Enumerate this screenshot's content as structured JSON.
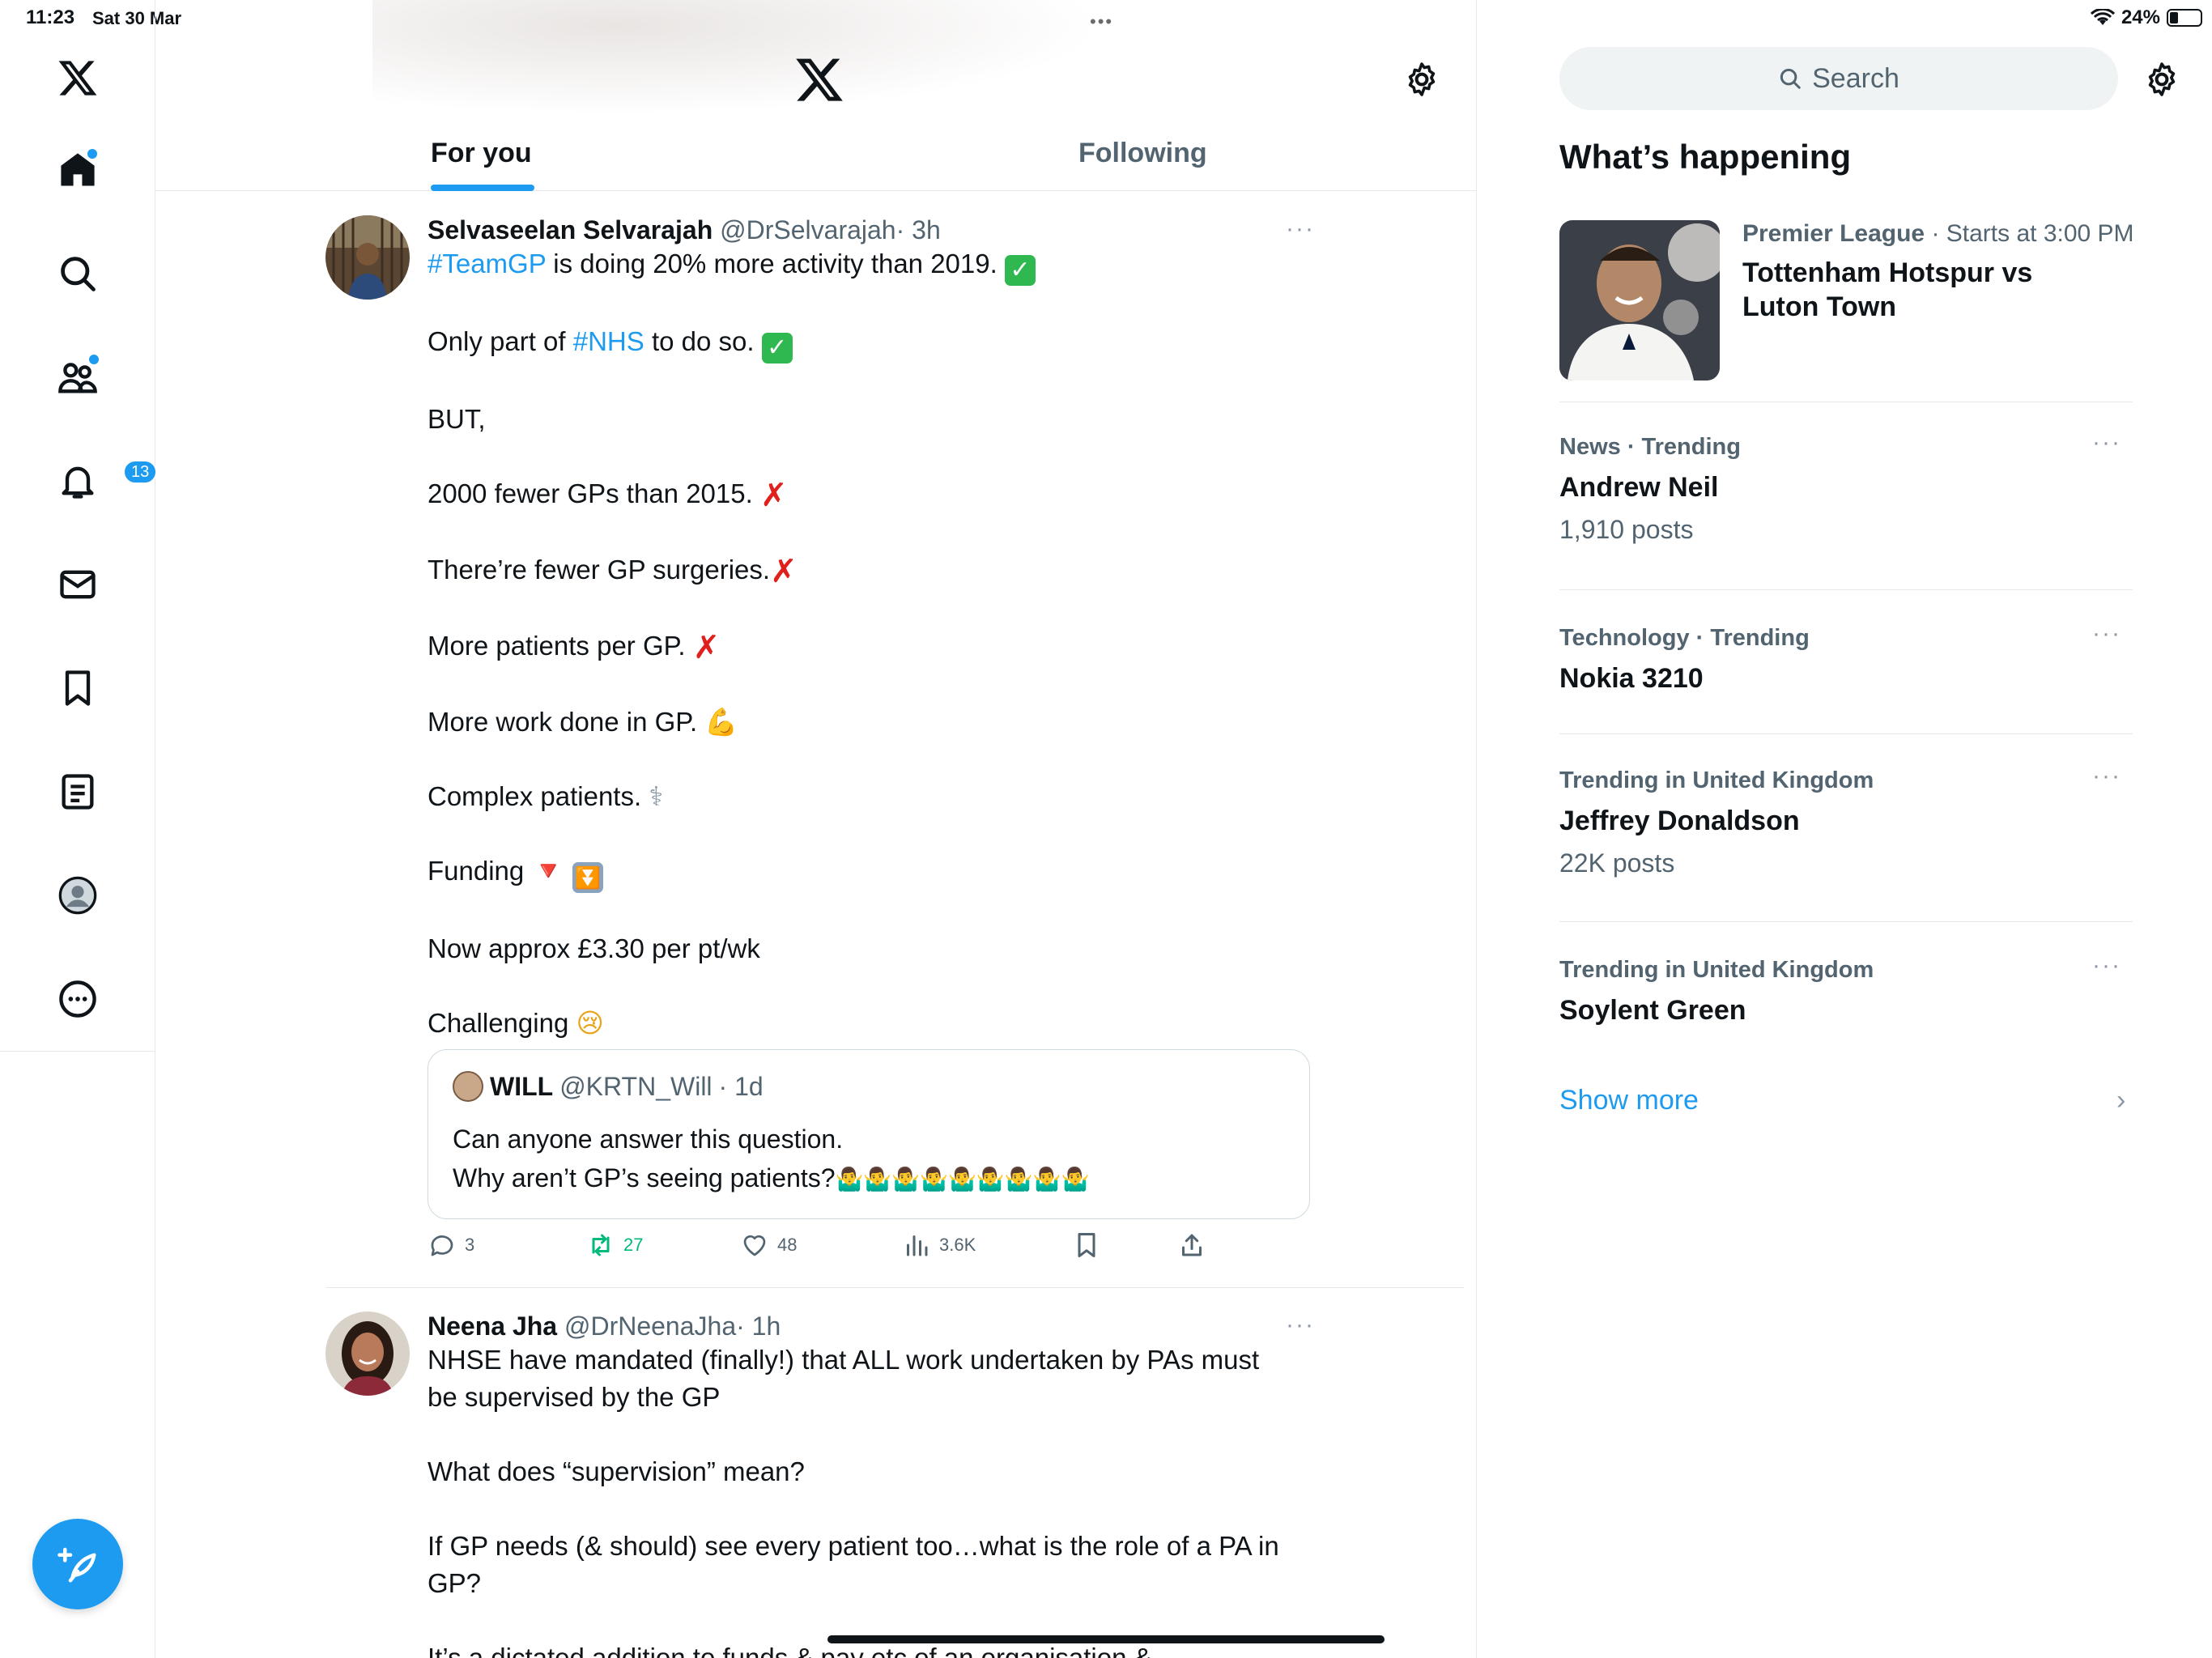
{
  "status_bar": {
    "time": "11:23",
    "date": "Sat 30 Mar",
    "battery_percent": "24%",
    "battery_level": 0.24,
    "multitask_dots": "•••"
  },
  "colors": {
    "accent": "#1d9bf0",
    "text": "#0f1419",
    "secondary": "#536471",
    "border": "#e6e9eb"
  },
  "nav": {
    "items": [
      {
        "icon": "x-logo-icon"
      },
      {
        "icon": "home-icon",
        "has_dot": true
      },
      {
        "icon": "search-icon"
      },
      {
        "icon": "communities-icon",
        "has_dot": true
      },
      {
        "icon": "notifications-icon",
        "badge": "13"
      },
      {
        "icon": "messages-icon"
      },
      {
        "icon": "bookmarks-icon"
      },
      {
        "icon": "lists-icon"
      },
      {
        "icon": "profile-icon"
      },
      {
        "icon": "more-icon"
      }
    ],
    "compose_icon": "compose-feather-icon"
  },
  "timeline": {
    "tabs": [
      {
        "label": "For you",
        "active": true
      },
      {
        "label": "Following",
        "active": false
      }
    ],
    "tweets": [
      {
        "name": "Selvaseelan Selvarajah",
        "handle": "@DrSelvarajah",
        "time": "· 3h",
        "more": "···",
        "lines": {
          "l1_hashtag": "#TeamGP",
          "l1_text": " is doing 20% more activity than 2019. ",
          "l2_pre": "Only part of ",
          "l2_hashtag": "#NHS",
          "l2_post": " to do so. ",
          "l3": "BUT,",
          "l4": "2000 fewer GPs than 2015. ",
          "l5": "There’re fewer GP surgeries.",
          "l6": "More patients per GP. ",
          "l7": "More work done in GP. ",
          "l8": "Complex patients. ",
          "l9": "Funding ",
          "l10": "Now approx £3.30 per pt/wk",
          "l11": "Challenging "
        },
        "emoji": {
          "check": "✓",
          "cross": "✗",
          "muscle": "💪",
          "stethoscope": "⚕",
          "down_triangle": "🔻",
          "down_double": "⏬",
          "crying": "😢"
        },
        "quote": {
          "name": "WILL",
          "handle": "@KRTN_Will",
          "time": "· 1d",
          "line1": "Can anyone answer this question.",
          "line2": "Why aren’t GP’s seeing patients?",
          "shrugs": "🤷‍♂️🤷‍♂️🤷‍♂️🤷‍♂️🤷‍♂️🤷‍♂️🤷‍♂️🤷‍♂️🤷‍♂️"
        },
        "stats": {
          "replies": "3",
          "reposts": "27",
          "likes": "48",
          "views": "3.6K"
        }
      },
      {
        "name": "Neena Jha",
        "handle": "@DrNeenaJha",
        "time": "· 1h",
        "more": "···",
        "lines": {
          "l1": "NHSE have mandated (finally!) that ALL work undertaken by PAs must",
          "l2": "be supervised by the GP",
          "l3": "What does “supervision” mean?",
          "l4": "If GP needs (& should) see every patient too…what is the role of a PA in",
          "l5": "GP?",
          "l6": "It’s a dictated addition to funds & pay etc of an organisation &..."
        }
      }
    ]
  },
  "sidebar": {
    "search_placeholder": "Search",
    "title": "What’s happening",
    "event": {
      "league": "Premier League",
      "when": " · Starts at 3:00 PM",
      "title": "Tottenham Hotspur vs Luton Town"
    },
    "trends": [
      {
        "meta": "News · Trending",
        "name": "Andrew Neil",
        "posts": "1,910 posts"
      },
      {
        "meta": "Technology · Trending",
        "name": "Nokia 3210",
        "posts": ""
      },
      {
        "meta": "Trending in United Kingdom",
        "name": "Jeffrey Donaldson",
        "posts": "22K posts"
      },
      {
        "meta": "Trending in United Kingdom",
        "name": "Soylent Green",
        "posts": ""
      }
    ],
    "trend_more": "···",
    "show_more": "Show more",
    "show_more_chevron": "›"
  }
}
